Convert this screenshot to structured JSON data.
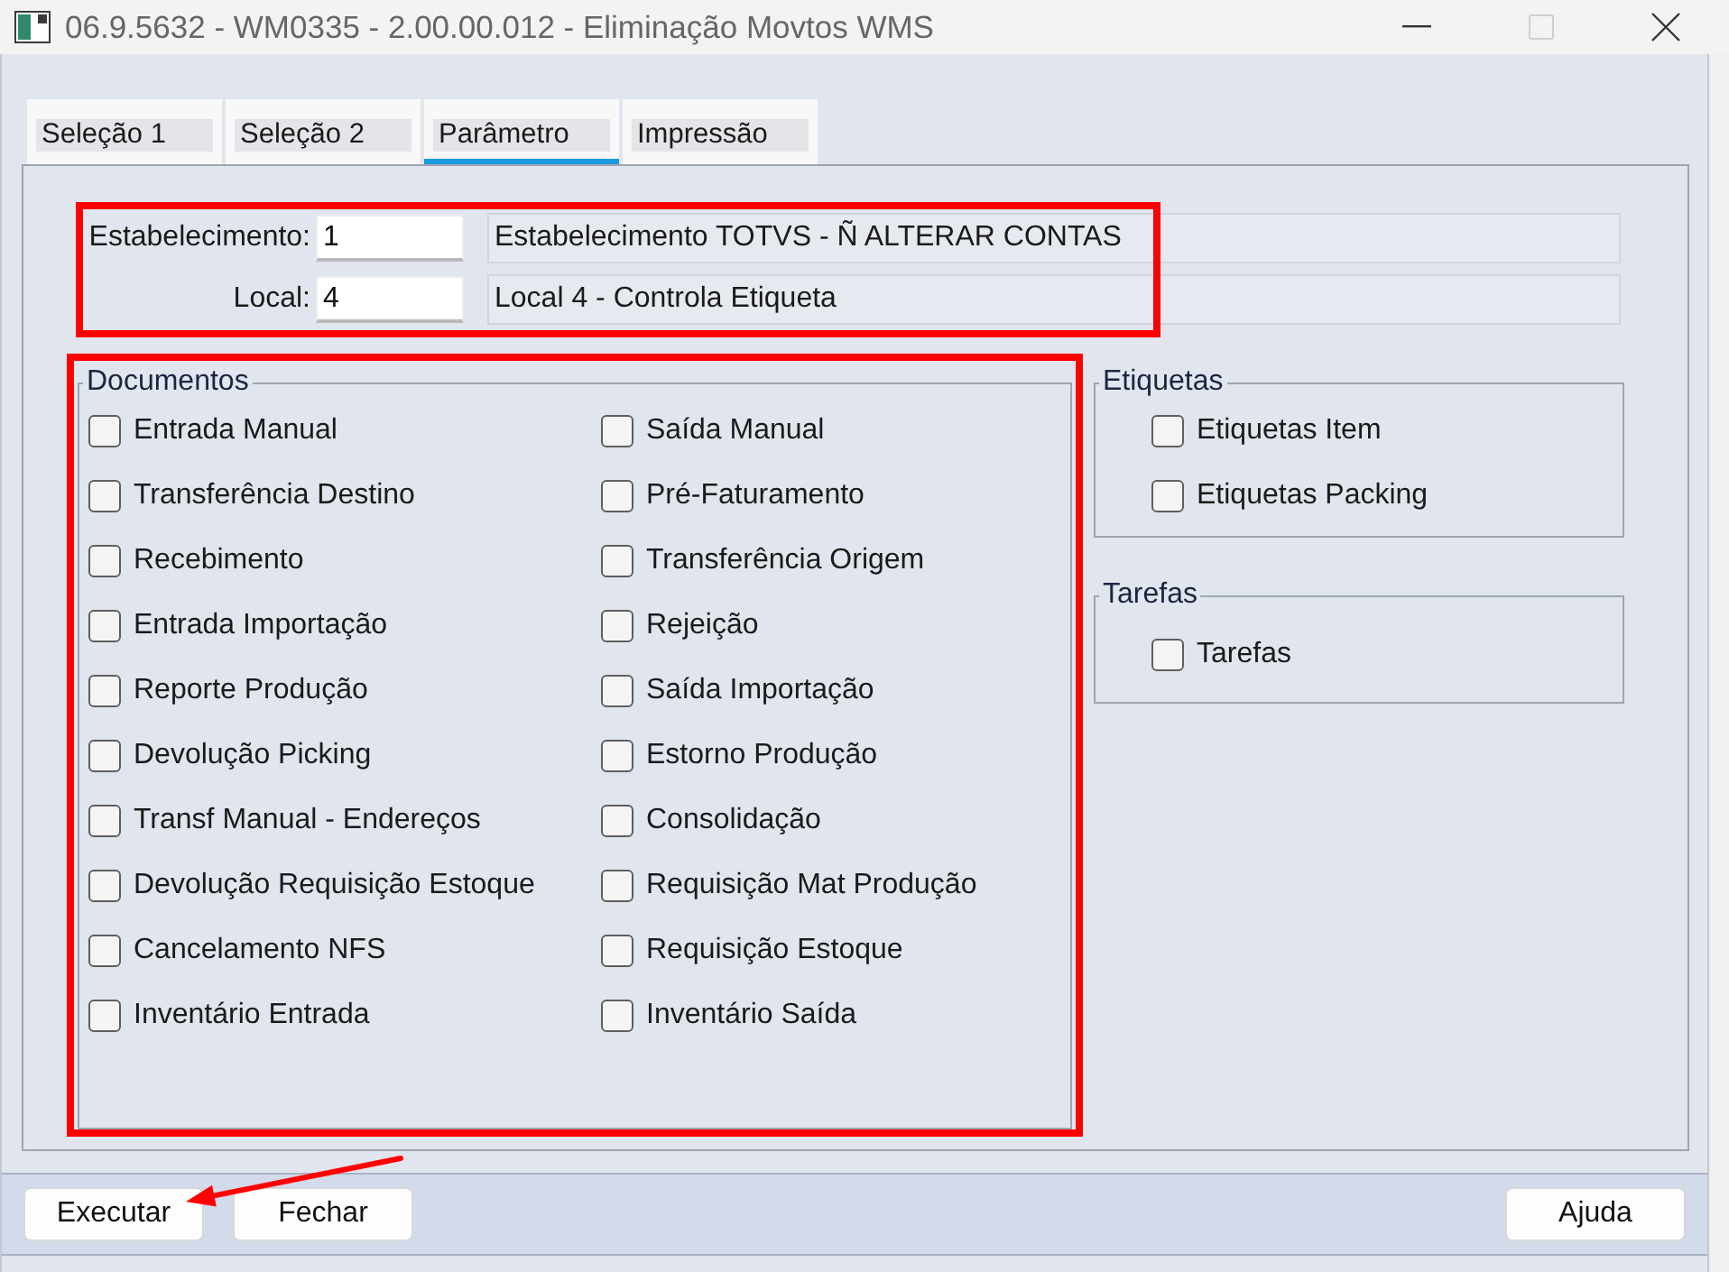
{
  "window": {
    "title": "06.9.5632 - WM0335 - 2.00.00.012 - Eliminação Movtos WMS",
    "maximize_disabled": true
  },
  "tabs": [
    {
      "label": "Seleção 1",
      "selected": false
    },
    {
      "label": "Seleção 2",
      "selected": false
    },
    {
      "label": "Parâmetro",
      "selected": true
    },
    {
      "label": "Impressão",
      "selected": false
    }
  ],
  "fields": {
    "highlighted": true,
    "rows": [
      {
        "label": "Estabelecimento:",
        "value": "1",
        "description": "Estabelecimento TOTVS - Ñ ALTERAR CONTAS"
      },
      {
        "label": "Local:",
        "value": "4",
        "description": "Local 4 - Controla Etiqueta"
      }
    ]
  },
  "documents": {
    "title": "Documentos",
    "highlighted": true,
    "columns": [
      {
        "items": [
          {
            "label": "Entrada Manual",
            "checked": false
          },
          {
            "label": "Transferência Destino",
            "checked": false
          },
          {
            "label": "Recebimento",
            "checked": false
          },
          {
            "label": "Entrada Importação",
            "checked": false
          },
          {
            "label": "Reporte Produção",
            "checked": false
          },
          {
            "label": "Devolução Picking",
            "checked": false
          },
          {
            "label": "Transf Manual - Endereços",
            "checked": false
          },
          {
            "label": "Devolução Requisição Estoque",
            "checked": false
          },
          {
            "label": "Cancelamento NFS",
            "checked": false
          },
          {
            "label": "Inventário Entrada",
            "checked": false
          }
        ]
      },
      {
        "items": [
          {
            "label": "Saída Manual",
            "checked": false
          },
          {
            "label": "Pré-Faturamento",
            "checked": false
          },
          {
            "label": "Transferência Origem",
            "checked": false
          },
          {
            "label": "Rejeição",
            "checked": false
          },
          {
            "label": "Saída Importação",
            "checked": false
          },
          {
            "label": "Estorno Produção",
            "checked": false
          },
          {
            "label": "Consolidação",
            "checked": false
          },
          {
            "label": "Requisição Mat Produção",
            "checked": false
          },
          {
            "label": "Requisição Estoque",
            "checked": false
          },
          {
            "label": "Inventário Saída",
            "checked": false
          }
        ]
      }
    ]
  },
  "side_groups": [
    {
      "title": "Etiquetas",
      "highlighted": false,
      "items": [
        {
          "label": "Etiquetas Item",
          "checked": false
        },
        {
          "label": "Etiquetas Packing",
          "checked": false
        }
      ]
    },
    {
      "title": "Tarefas",
      "highlighted": false,
      "items": [
        {
          "label": "Tarefas",
          "checked": false
        }
      ]
    }
  ],
  "actions": {
    "left": [
      "Executar",
      "Fechar"
    ],
    "right": [
      "Ajuda"
    ]
  },
  "annotation_arrow": true
}
